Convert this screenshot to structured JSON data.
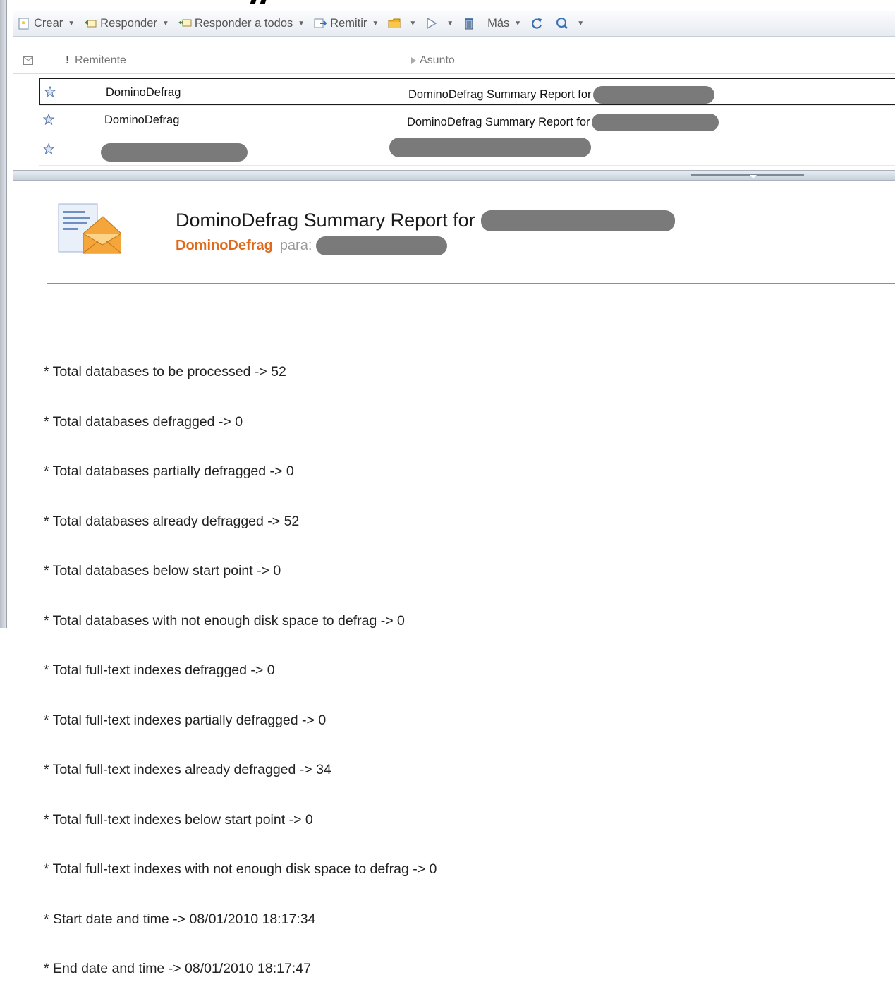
{
  "toolbar": {
    "items": [
      {
        "label": "Crear",
        "icon": "new-memo-icon"
      },
      {
        "label": "Responder",
        "icon": "reply-icon"
      },
      {
        "label": "Responder a todos",
        "icon": "reply-all-icon"
      },
      {
        "label": "Remitir",
        "icon": "forward-icon"
      },
      {
        "label": "",
        "icon": "folder-icon"
      },
      {
        "label": "",
        "icon": "follow-up-flag-icon"
      },
      {
        "label": "",
        "icon": "trash-icon"
      },
      {
        "label": "Más",
        "icon": ""
      },
      {
        "label": "",
        "icon": "refresh-icon"
      },
      {
        "label": "",
        "icon": "search-icon"
      }
    ]
  },
  "list": {
    "columns": {
      "sender": "Remitente",
      "subject": "Asunto"
    },
    "rows": [
      {
        "sender": "DominoDefrag",
        "subject": "DominoDefrag Summary Report for",
        "selected": true
      },
      {
        "sender": "DominoDefrag",
        "subject": "DominoDefrag Summary Report for",
        "selected": false
      },
      {
        "sender": "",
        "subject": "",
        "selected": false
      }
    ]
  },
  "preview": {
    "subject": "DominoDefrag Summary Report for",
    "from": "DominoDefrag",
    "to_label": "para:",
    "body": [
      "* Total databases to be processed -> 52",
      "* Total databases defragged -> 0",
      "* Total databases partially defragged -> 0",
      "* Total databases already defragged -> 52",
      "* Total databases below start point -> 0",
      "* Total databases with not enough disk space to defrag -> 0",
      "* Total full-text indexes defragged -> 0",
      "* Total full-text indexes partially defragged -> 0",
      "* Total full-text indexes already defragged -> 34",
      "* Total full-text indexes below start point -> 0",
      "* Total full-text indexes with not enough disk space to defrag -> 0",
      "* Start date and time -> 08/01/2010 18:17:34",
      "* End date and time -> 08/01/2010 18:17:47"
    ]
  },
  "colors": {
    "sender_accent": "#e06a1b",
    "redaction": "#7a7a7a",
    "selection_border": "#1b1b1b"
  }
}
